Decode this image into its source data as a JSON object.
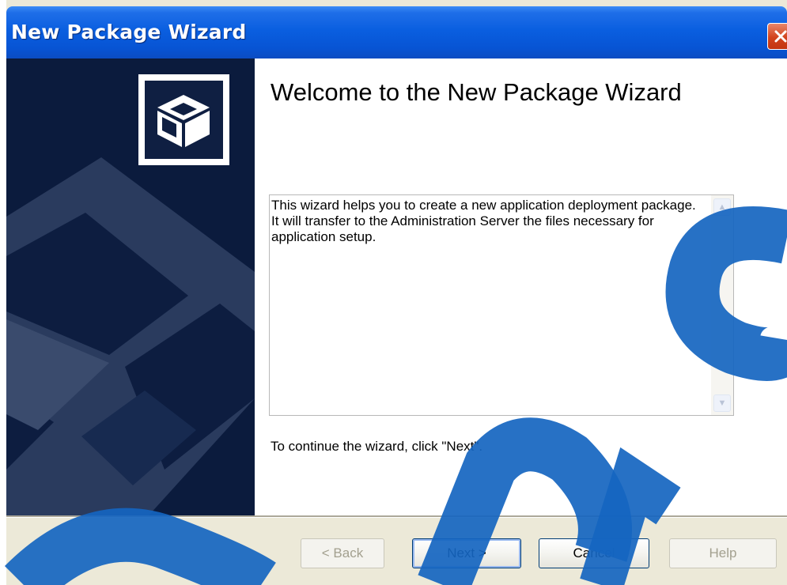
{
  "window": {
    "title": "New Package Wizard"
  },
  "welcome": {
    "title": "Welcome to the New Package Wizard",
    "description": "This wizard helps you to create a new application deployment package.\nIt will transfer to the Administration Server the files necessary for application setup.",
    "continue_hint": "To continue the wizard, click \"Next\"."
  },
  "buttons": {
    "back": "< Back",
    "next": "Next >",
    "cancel": "Cancel",
    "help": "Help"
  },
  "icons": {
    "close": "close-icon",
    "logo": "package-box-icon",
    "scroll_up": "scroll-up-arrow-icon",
    "scroll_down": "scroll-down-arrow-icon"
  },
  "colors": {
    "titlebar": "#0a5fe0",
    "banner": "#0b1b3d",
    "close_button": "#d2431d",
    "watermark": "#1565c0"
  }
}
